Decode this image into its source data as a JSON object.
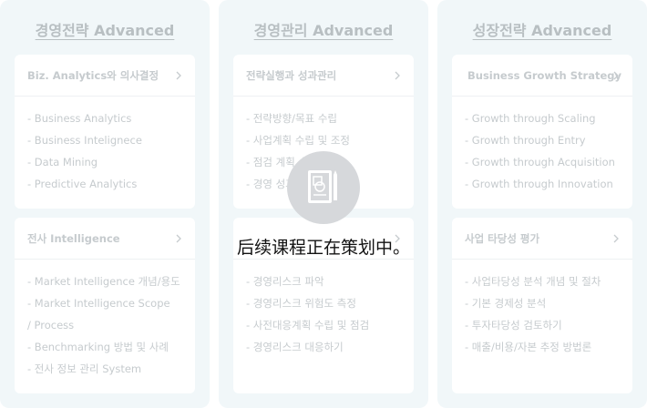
{
  "columns": [
    {
      "title": "경영전략 Advanced",
      "cards": [
        {
          "title": "Biz. Analytics와 의사결정",
          "items": [
            "- Business Analytics",
            "- Business Intelignece",
            "- Data Mining",
            "- Predictive Analytics"
          ]
        },
        {
          "title": "전사 Intelligence",
          "items": [
            "- Market Intelligence 개념/용도",
            "- Market Intelligence Scope",
            "/ Process",
            "- Benchmarking 방법 및 사례",
            "- 전사 정보 관리 System"
          ]
        }
      ]
    },
    {
      "title": "경영관리 Advanced",
      "cards": [
        {
          "title": "전략실행과 성과관리",
          "items": [
            "- 전략방향/목표 수립",
            "- 사업계획 수립 및 조정",
            "- 점검 계획 수립",
            "- 경영 성과"
          ]
        },
        {
          "title": "",
          "items": [
            "- 경영리스크 파악",
            "- 경영리스크 위험도 측정",
            "- 사전대응계획 수립 및 점검",
            "- 경영리스크 대응하기"
          ]
        }
      ]
    },
    {
      "title": "성장전략 Advanced",
      "cards": [
        {
          "title": "Business Growth Strategy",
          "items": [
            "- Growth through Scaling",
            "- Growth through Entry",
            "- Growth through Acquisition",
            "- Growth through Innovation"
          ]
        },
        {
          "title": "사업 타당성 평가",
          "items": [
            "- 사업타당성 분석 개념 및 절차",
            "- 기본 경제성 분석",
            "- 투자타당성 검토하기",
            "- 매출/비용/자본 추정 방법론"
          ]
        }
      ]
    }
  ],
  "overlay": {
    "message": "后续课程正在策划中。",
    "icon": "document-icon"
  },
  "colors": {
    "column_bg": "#f1f7f9",
    "card_bg": "#ffffff",
    "faded_text": "#c6cbce",
    "overlay_circle": "#d6d8db"
  }
}
